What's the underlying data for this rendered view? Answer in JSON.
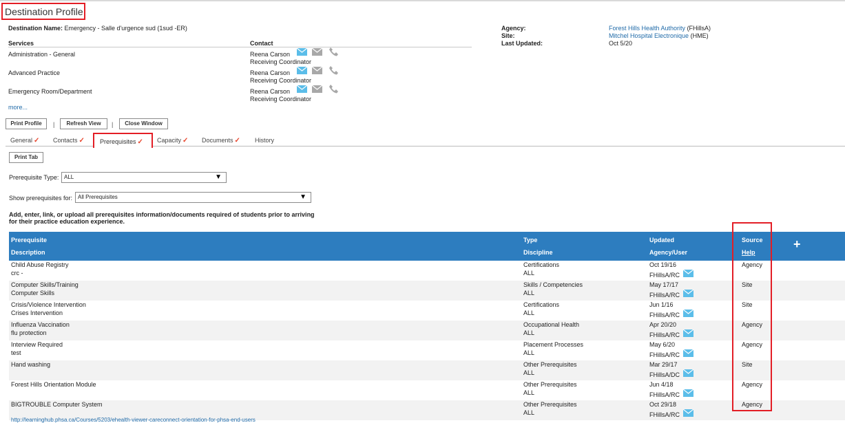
{
  "page": {
    "title": "Destination Profile"
  },
  "destination": {
    "name_label": "Destination Name:",
    "name_value": "Emergency - Salle d'urgence sud (1sud -ER)"
  },
  "info": {
    "agency_label": "Agency:",
    "agency_link": "Forest Hills Health Authority",
    "agency_code": "(FHillsA)",
    "site_label": "Site:",
    "site_link": "Mitchel Hospital Electronique",
    "site_code": "(HME)",
    "updated_label": "Last Updated:",
    "updated_value": "Oct 5/20"
  },
  "services": {
    "header_services": "Services",
    "header_contact": "Contact",
    "rows": [
      {
        "service": "Administration - General",
        "contact_name": "Reena Carson",
        "contact_role": "Receiving Coordinator"
      },
      {
        "service": "Advanced Practice",
        "contact_name": "Reena Carson",
        "contact_role": "Receiving Coordinator"
      },
      {
        "service": "Emergency Room/Department",
        "contact_name": "Reena Carson",
        "contact_role": "Receiving Coordinator"
      }
    ],
    "more_link": "more..."
  },
  "actions": {
    "print_profile": "Print Profile",
    "refresh_view": "Refresh View",
    "close_window": "Close Window",
    "separator": "|"
  },
  "tabs": [
    {
      "label": "General",
      "checked": true
    },
    {
      "label": "Contacts",
      "checked": true
    },
    {
      "label": "Prerequisites",
      "checked": true
    },
    {
      "label": "Capacity",
      "checked": true
    },
    {
      "label": "Documents",
      "checked": true
    },
    {
      "label": "History",
      "checked": false
    }
  ],
  "check_glyph": "✓",
  "print_tab": "Print Tab",
  "filters": {
    "type_label": "Prerequisite Type:",
    "type_value": "ALL",
    "show_label": "Show prerequisites for:",
    "show_value": "All Prerequisites"
  },
  "instructions": {
    "line1": "Add, enter, link, or upload all prerequisites information/documents required of students prior to arriving",
    "line2": "for their practice education experience."
  },
  "table": {
    "h_prerequisite": "Prerequisite",
    "h_description": "Description",
    "h_type": "Type",
    "h_discipline": "Discipline",
    "h_updated": "Updated",
    "h_agency_user": "Agency/User",
    "h_source": "Source",
    "h_help": "Help",
    "add_glyph": "+",
    "rows": [
      {
        "prerequisite": "Child Abuse Registry",
        "description": "crc -",
        "type": "Certifications",
        "discipline": "ALL",
        "updated": "Oct 19/16",
        "user": "FHillsA/RC",
        "source": "Agency"
      },
      {
        "prerequisite": "Computer Skills/Training",
        "description": "Computer Skills",
        "type": "Skills / Competencies",
        "discipline": "ALL",
        "updated": "May 17/17",
        "user": "FHillsA/RC",
        "source": "Site"
      },
      {
        "prerequisite": "Crisis/Violence Intervention",
        "description": "Crises Intervention",
        "type": "Certifications",
        "discipline": "ALL",
        "updated": "Jun 1/16",
        "user": "FHillsA/RC",
        "source": "Site"
      },
      {
        "prerequisite": "Influenza Vaccination",
        "description": "flu protection",
        "type": "Occupational Health",
        "discipline": "ALL",
        "updated": "Apr 20/20",
        "user": "FHillsA/RC",
        "source": "Agency"
      },
      {
        "prerequisite": "Interview Required",
        "description": "test",
        "type": "Placement Processes",
        "discipline": "ALL",
        "updated": "May 6/20",
        "user": "FHillsA/RC",
        "source": "Agency"
      },
      {
        "prerequisite": "Hand washing",
        "description": "",
        "type": "Other Prerequisites",
        "discipline": "ALL",
        "updated": "Mar 29/17",
        "user": "FHillsA/DC",
        "source": "Site"
      },
      {
        "prerequisite": "Forest Hills Orientation Module",
        "description": "",
        "type": "Other Prerequisites",
        "discipline": "ALL",
        "updated": "Jun 4/18",
        "user": "FHillsA/RC",
        "source": "Agency"
      },
      {
        "prerequisite": "BIGTROUBLE Computer System",
        "description": "",
        "type": "Other Prerequisites",
        "discipline": "ALL",
        "updated": "Oct 29/18",
        "user": "FHillsA/RC",
        "source": "Agency"
      }
    ],
    "bottom_link": "http://learninghub.phsa.ca/Courses/5203/ehealth-viewer-careconnect-orientation-for-phsa-end-users"
  },
  "colors": {
    "header_blue": "#2d7dbf",
    "highlight_red": "#e31d25",
    "check_orange": "#e8452c",
    "mail_blue": "#5bbde9",
    "icon_grey": "#a8a8a8"
  }
}
